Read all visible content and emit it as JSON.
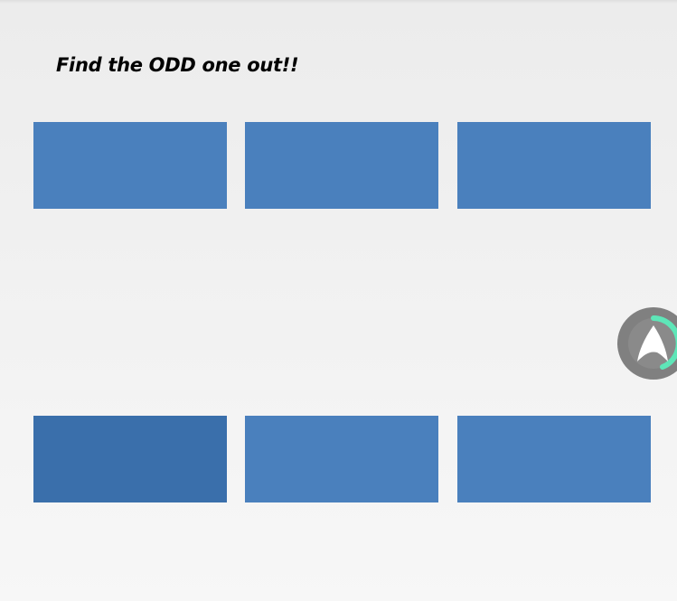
{
  "game": {
    "title": "Find the ODD one out!!",
    "colors": {
      "tile_normal": "#4a80bd",
      "tile_odd": "#3a6fab"
    },
    "tiles": [
      {
        "odd": false
      },
      {
        "odd": false
      },
      {
        "odd": false
      },
      {
        "odd": true
      },
      {
        "odd": false
      },
      {
        "odd": false
      }
    ]
  },
  "floating_button": {
    "icon": "arrow-logo-icon",
    "colors": {
      "background": "#808080",
      "ring": "#5ee6b8",
      "glyph": "#ffffff"
    }
  }
}
